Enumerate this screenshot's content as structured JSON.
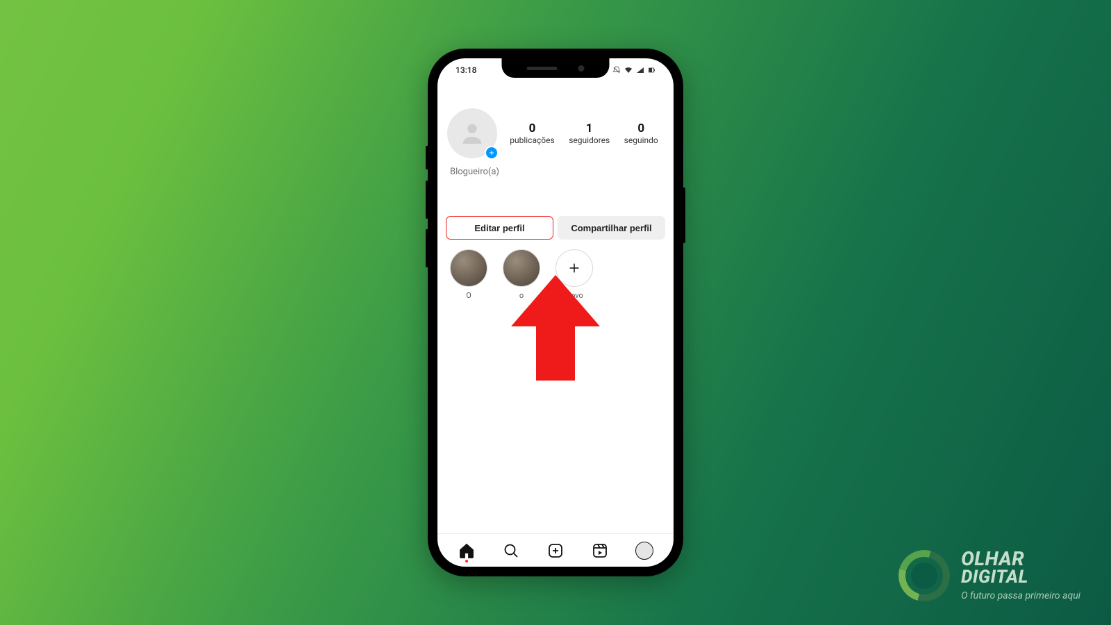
{
  "status": {
    "time": "13:18"
  },
  "profile": {
    "bio": "Blogueiro(a)",
    "stats": {
      "posts": {
        "count": "0",
        "label": "publicações"
      },
      "followers": {
        "count": "1",
        "label": "seguidores"
      },
      "following": {
        "count": "0",
        "label": "seguindo"
      }
    },
    "buttons": {
      "edit": "Editar perfil",
      "share": "Compartilhar perfil"
    },
    "highlights": {
      "h1_label": "O",
      "h2_label": "o",
      "new_label": "Novo"
    }
  },
  "annotation": {
    "arrow_color": "#ef1b1b",
    "points_to": "edit-profile-button"
  },
  "brand": {
    "line1": "OLHAR",
    "line2": "DIGITAL",
    "tagline": "O futuro passa primeiro aqui"
  }
}
